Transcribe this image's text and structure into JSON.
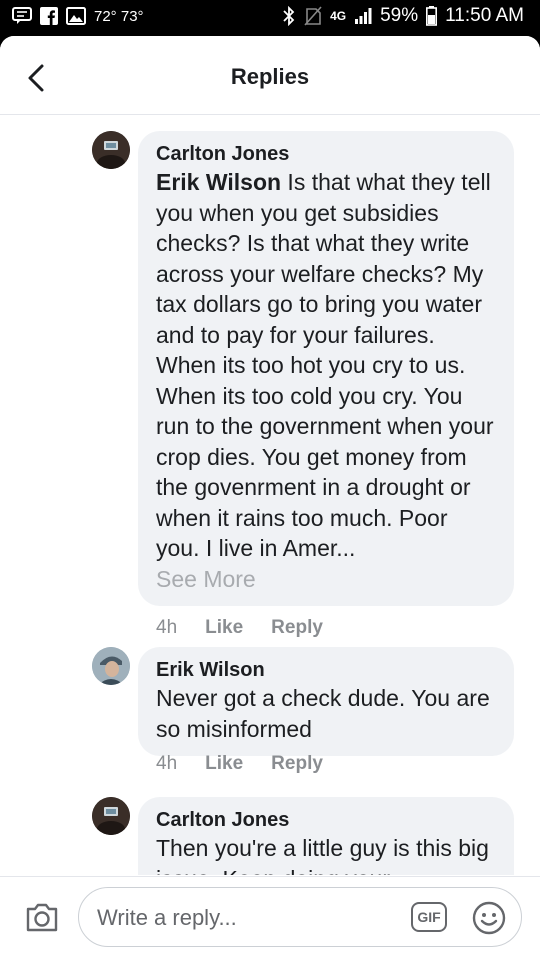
{
  "status_bar": {
    "temperature": "72° 73°",
    "network": "4G",
    "battery": "59%",
    "time": "11:50 AM",
    "left_icons": [
      "message-icon",
      "facebook-icon",
      "image-icon"
    ],
    "right_icons": [
      "bluetooth-icon",
      "no-sim-icon",
      "signal-icon",
      "battery-icon"
    ]
  },
  "header": {
    "title": "Replies",
    "back_icon": "chevron-left-icon"
  },
  "replies": [
    {
      "author": "Carlton Jones",
      "mention": "Erik Wilson",
      "text": " Is that what they tell you when you get subsidies checks?  Is that what they write across your welfare checks?  My tax dollars go to bring you water and to pay for your failures.  When its too hot you cry to us. When its too cold you cry.  You run to the government when your crop dies.  You get money from the govenrment in a drought or when it rains too much.  Poor you.  I live in Amer...",
      "see_more": "See More",
      "time": "4h",
      "like": "Like",
      "reply": "Reply"
    },
    {
      "author": "Erik Wilson",
      "text": "Never got a check dude. You are so misinformed",
      "time": "4h",
      "like": "Like",
      "reply": "Reply"
    },
    {
      "author": "Carlton Jones",
      "text": "Then you're a little guy is this big issue.  Keep doing your"
    }
  ],
  "composer": {
    "placeholder": "Write a reply...",
    "gif_label": "GIF",
    "camera_icon": "camera-icon",
    "emoji_icon": "emoji-icon"
  },
  "colors": {
    "bubble": "#f0f2f5",
    "text": "#1c1e21",
    "muted": "#8a8d91"
  }
}
